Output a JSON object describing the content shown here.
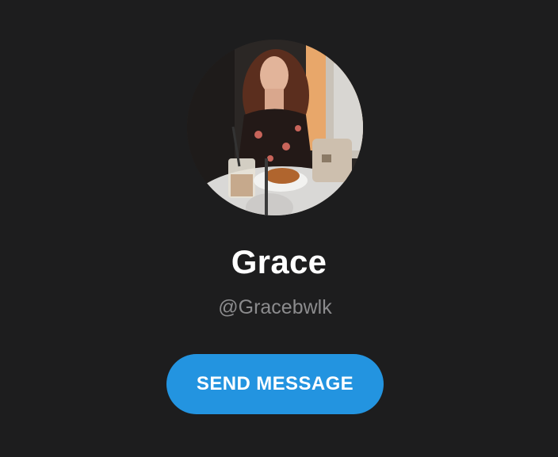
{
  "profile": {
    "name": "Grace",
    "handle": "@Gracebwlk",
    "avatar_icon": "profile-photo"
  },
  "actions": {
    "send_message_label": "SEND MESSAGE"
  },
  "colors": {
    "background": "#1d1d1e",
    "button": "#2394e0",
    "name_text": "#ffffff",
    "handle_text": "#8b8b8d"
  }
}
